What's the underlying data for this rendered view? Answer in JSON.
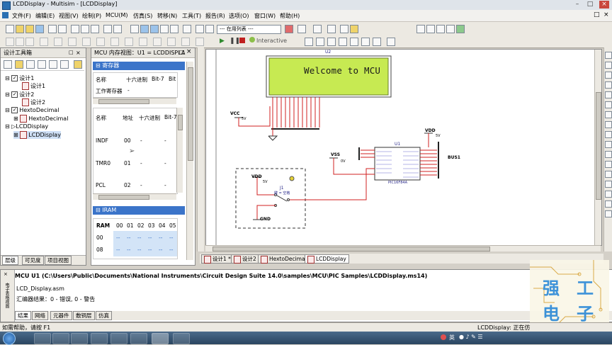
{
  "window": {
    "title": "LCDDisplay - Multisim - [LCDDisplay]"
  },
  "menu": [
    {
      "label": "文件(F)"
    },
    {
      "label": "编辑(E)"
    },
    {
      "label": "视图(V)"
    },
    {
      "label": "绘制(P)"
    },
    {
      "label": "MCU(M)"
    },
    {
      "label": "仿真(S)"
    },
    {
      "label": "转移(N)"
    },
    {
      "label": "工具(T)"
    },
    {
      "label": "报告(R)"
    },
    {
      "label": "选项(O)"
    },
    {
      "label": "窗口(W)"
    },
    {
      "label": "帮助(H)"
    }
  ],
  "toolbar": {
    "inuse_list": "--- 在用列表 ---",
    "interactive_label": "Interactive"
  },
  "design_toolbox": {
    "title": "设计工具箱",
    "tree": [
      {
        "label": "设计1",
        "level": 0,
        "kind": "check"
      },
      {
        "label": "设计1",
        "level": 1,
        "kind": "doc"
      },
      {
        "label": "设计2",
        "level": 0,
        "kind": "check"
      },
      {
        "label": "设计2",
        "level": 1,
        "kind": "doc"
      },
      {
        "label": "HextoDecimal",
        "level": 0,
        "kind": "check"
      },
      {
        "label": "HextoDecimal",
        "level": 1,
        "kind": "doc"
      },
      {
        "label": "LCDDisplay",
        "level": 0,
        "kind": "tri"
      },
      {
        "label": "LCDDisplay",
        "level": 1,
        "kind": "doc"
      }
    ],
    "tabs": [
      "层级",
      "可见度",
      "项目视图"
    ]
  },
  "mcu_view": {
    "title": "MCU 内存视图：U1 = LCDDISPLA",
    "registers_header": "寄存器",
    "reg_cols": [
      "名称",
      "十六进制",
      "Bit-7",
      "Bit"
    ],
    "reg_row": {
      "name": "工作寄存器",
      "value": "-"
    },
    "sfr_cols": [
      "名称",
      "地址",
      "十六进制",
      "Bit-7"
    ],
    "sfr_rows": [
      {
        "name": "INDF",
        "addr": "00",
        "hex": "-",
        "bit": "-"
      },
      {
        "name": "TMR0",
        "addr": "01",
        "hex": "-",
        "bit": "-"
      },
      {
        "name": "PCL",
        "addr": "02",
        "hex": "-",
        "bit": "-"
      }
    ],
    "iram_header": "IRAM",
    "iram_cols": [
      "RAM",
      "00",
      "01",
      "02",
      "03",
      "04",
      "05"
    ],
    "iram_rows": [
      {
        "label": "00",
        "vals": [
          "--",
          "--",
          "--",
          "--",
          "--",
          "--"
        ]
      },
      {
        "label": "08",
        "vals": [
          "--",
          "--",
          "--",
          "--",
          "--",
          "--"
        ]
      }
    ]
  },
  "schematic": {
    "u2_label": "U2",
    "lcd_text": "Welcome to MCU",
    "vcc_label": "VCC",
    "vcc_v": "5V",
    "vdd_label": "VDD",
    "vdd_v": "5V",
    "vss_label": "VSS",
    "vss_v": "0V",
    "u1_label": "U1",
    "chip_name": "PIC16F84A",
    "bus_label": "BUS1",
    "vdd2_label": "VDD",
    "vdd2_v": "5V",
    "j1_label": "J1",
    "j1_key": "键 = 空格",
    "gnd_label": "GND",
    "tabs": [
      "设计1 *",
      "设计2",
      "HextoDecimal",
      "LCDDisplay"
    ]
  },
  "output": {
    "path": "MCU U1 (C:\\Users\\Public\\Documents\\National Instruments\\Circuit Design Suite 14.0\\samples\\MCU\\PIC Samples\\LCDDisplay.ms14)",
    "file": "LCD_Display.asm",
    "result": "汇编器结果：0 - 错误, 0 - 警告",
    "side_label": "电子表格视图",
    "tabs": [
      "结果",
      "网络",
      "元器件",
      "敷铜层",
      "仿真"
    ]
  },
  "status": {
    "left": "如需帮助，请按 F1",
    "right": "LCDDisplay: 正在仿"
  },
  "watermark": {
    "chars": [
      "强",
      "工",
      "电",
      "子"
    ]
  },
  "taskbar": {
    "lang": "英"
  },
  "colors": {
    "lcd_bg": "#c7ea52",
    "lcd_text": "#1a1a1a",
    "accent": "#3b74c9",
    "wire": "#d02020"
  }
}
